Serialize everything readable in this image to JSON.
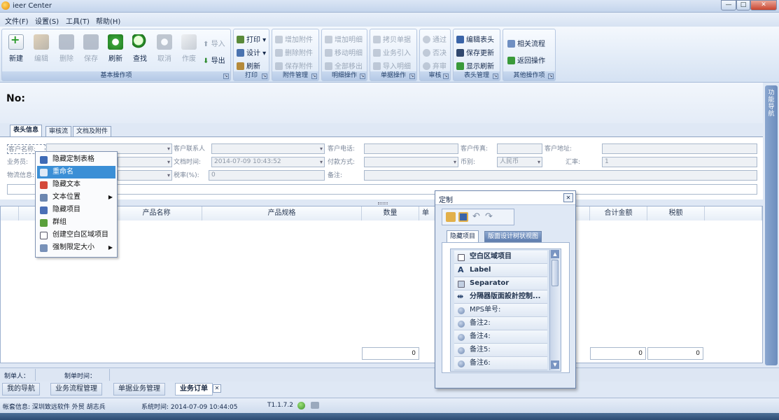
{
  "window": {
    "title": "ieer Center",
    "minimize": "—",
    "maximize": "□",
    "close": "✕"
  },
  "menu": [
    "文件(F)",
    "设置(S)",
    "工具(T)",
    "帮助(H)"
  ],
  "ribbon": {
    "groups": [
      {
        "label": "基本操作项"
      },
      {
        "label": "打印"
      },
      {
        "label": "附件管理"
      },
      {
        "label": "明细操作"
      },
      {
        "label": "单据操作"
      },
      {
        "label": "审核"
      },
      {
        "label": "表头管理"
      },
      {
        "label": "其他操作项"
      }
    ],
    "basic": {
      "new": "新建",
      "edit": "编辑",
      "delete": "删除",
      "save": "保存",
      "refresh": "刷新",
      "find": "查找",
      "cancel": "取消",
      "void": "作废",
      "import": "导入",
      "export": "导出"
    },
    "print": {
      "print": "打印",
      "design": "设计",
      "refresh": "刷新"
    },
    "attach": {
      "add": "增加附件",
      "delete": "删除附件",
      "save": "保存附件"
    },
    "detail": {
      "add": "增加明细",
      "move": "移动明细",
      "clear": "全部移出"
    },
    "doc": {
      "copy": "拷贝单据",
      "import_item": "业务引入",
      "import_detail": "导入明细"
    },
    "audit": {
      "pass": "通过",
      "reject": "否决",
      "review": "弃审"
    },
    "header": {
      "edit": "编辑表头",
      "save_update": "保存更新",
      "show_refresh": "显示刷新"
    },
    "other": {
      "flow": "相关流程",
      "back": "返回操作"
    }
  },
  "document": {
    "no_label": "No:"
  },
  "right_panel": {
    "label": "功能导航"
  },
  "tabs": [
    "表头信息",
    "审核流",
    "文档及附件"
  ],
  "form": {
    "customer_name": "客户名称:",
    "contact": "客户联系人",
    "phone": "客户电话:",
    "fax": "客户传真:",
    "address": "客户地址:",
    "salesman": "业务员:",
    "doc_time_label": "文档时间:",
    "doc_time_value": "2014-07-09 10:43:52",
    "payment": "付款方式:",
    "currency_label": "币别:",
    "currency_value": "人民币",
    "rate_label": "汇率:",
    "rate_value": "1",
    "logistics": "物流信息:",
    "tax_label": "税率(%):",
    "tax_value": "0",
    "remark": "备注:"
  },
  "grid": {
    "headers": [
      "产品名称",
      "产品规格",
      "数量",
      "单",
      "合计金额",
      "税额"
    ],
    "footer_values": [
      "0",
      "0",
      "0"
    ]
  },
  "context_menu": [
    {
      "label": "隐藏定制表格",
      "icon": "hide-table-icon",
      "color": "#3e6ab5"
    },
    {
      "label": "重命名",
      "icon": "rename-icon",
      "color": "#dfe9f6",
      "selected": true
    },
    {
      "label": "隐藏文本",
      "icon": "hide-text-icon",
      "color": "#d4493a"
    },
    {
      "label": "文本位置",
      "icon": "text-position-icon",
      "color": "#6b86b0",
      "submenu": true
    },
    {
      "label": "隐藏项目",
      "icon": "hide-item-icon",
      "color": "#4a6fb6"
    },
    {
      "label": "群组",
      "icon": "group-icon",
      "color": "#5aa03c"
    },
    {
      "label": "创建空白区域项目",
      "icon": "empty-area-icon",
      "color": "#ffffff"
    },
    {
      "label": "强制限定大小",
      "icon": "force-size-icon",
      "color": "#7891b8",
      "submenu": true
    }
  ],
  "dialog": {
    "title": "定制",
    "close": "✕",
    "tabs": [
      "隐藏项目",
      "版面设计树状视图"
    ],
    "items": [
      {
        "label": "空白区域项目",
        "icon": "empty-area-icon"
      },
      {
        "label": "Label",
        "icon": "label-icon"
      },
      {
        "label": "Separator",
        "icon": "separator-icon"
      },
      {
        "label": "分隔器版面設計控制...",
        "icon": "splitter-icon"
      },
      {
        "label": "MPS单号:",
        "icon": "field-icon"
      },
      {
        "label": "备注2:",
        "icon": "field-icon"
      },
      {
        "label": "备注4:",
        "icon": "field-icon"
      },
      {
        "label": "备注5:",
        "icon": "field-icon"
      },
      {
        "label": "备注6:",
        "icon": "field-icon"
      }
    ]
  },
  "status_row": {
    "maker": "制单人：",
    "make_time": "制单时间："
  },
  "bottom_tabs": [
    "我的导航",
    "业务流程管理",
    "单据业务管理",
    "业务订单"
  ],
  "status": {
    "account": "帐套信息: 深圳致远软件  外贸  胡志兵",
    "system_time": "系统时间: 2014-07-09 10:44:05",
    "version": "T1.1.7.2"
  }
}
